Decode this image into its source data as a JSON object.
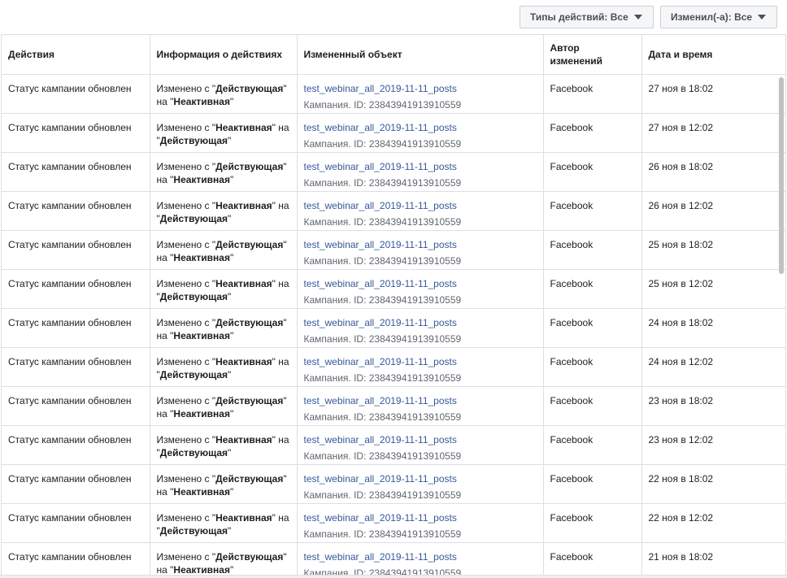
{
  "filters": {
    "action_types_label": "Типы действий: Все",
    "changed_by_label": "Изменил(-а): Все"
  },
  "columns": [
    "Действия",
    "Информация о действиях",
    "Измененный объект",
    "Автор изменений",
    "Дата и время"
  ],
  "info_strings": {
    "changed_from": "Изменено с \"",
    "mid_na_sp": "\" на ",
    "mid_na_nl": "\" на \"",
    "quote_open": "\"",
    "quote_close": "\"",
    "active": "Действующая",
    "inactive": "Неактивная"
  },
  "rows": [
    {
      "action": "Статус кампании обновлен",
      "from": "active",
      "object_name": "test_webinar_all_2019-11-11_posts",
      "object_id": "Кампания. ID: 23843941913910559",
      "author": "Facebook",
      "datetime": "27 ноя в 18:02"
    },
    {
      "action": "Статус кампании обновлен",
      "from": "inactive",
      "object_name": "test_webinar_all_2019-11-11_posts",
      "object_id": "Кампания. ID: 23843941913910559",
      "author": "Facebook",
      "datetime": "27 ноя в 12:02"
    },
    {
      "action": "Статус кампании обновлен",
      "from": "active",
      "object_name": "test_webinar_all_2019-11-11_posts",
      "object_id": "Кампания. ID: 23843941913910559",
      "author": "Facebook",
      "datetime": "26 ноя в 18:02"
    },
    {
      "action": "Статус кампании обновлен",
      "from": "inactive",
      "object_name": "test_webinar_all_2019-11-11_posts",
      "object_id": "Кампания. ID: 23843941913910559",
      "author": "Facebook",
      "datetime": "26 ноя в 12:02"
    },
    {
      "action": "Статус кампании обновлен",
      "from": "active",
      "object_name": "test_webinar_all_2019-11-11_posts",
      "object_id": "Кампания. ID: 23843941913910559",
      "author": "Facebook",
      "datetime": "25 ноя в 18:02"
    },
    {
      "action": "Статус кампании обновлен",
      "from": "inactive",
      "object_name": "test_webinar_all_2019-11-11_posts",
      "object_id": "Кампания. ID: 23843941913910559",
      "author": "Facebook",
      "datetime": "25 ноя в 12:02"
    },
    {
      "action": "Статус кампании обновлен",
      "from": "active",
      "object_name": "test_webinar_all_2019-11-11_posts",
      "object_id": "Кампания. ID: 23843941913910559",
      "author": "Facebook",
      "datetime": "24 ноя в 18:02"
    },
    {
      "action": "Статус кампании обновлен",
      "from": "inactive",
      "object_name": "test_webinar_all_2019-11-11_posts",
      "object_id": "Кампания. ID: 23843941913910559",
      "author": "Facebook",
      "datetime": "24 ноя в 12:02"
    },
    {
      "action": "Статус кампании обновлен",
      "from": "active",
      "object_name": "test_webinar_all_2019-11-11_posts",
      "object_id": "Кампания. ID: 23843941913910559",
      "author": "Facebook",
      "datetime": "23 ноя в 18:02"
    },
    {
      "action": "Статус кампании обновлен",
      "from": "inactive",
      "object_name": "test_webinar_all_2019-11-11_posts",
      "object_id": "Кампания. ID: 23843941913910559",
      "author": "Facebook",
      "datetime": "23 ноя в 12:02"
    },
    {
      "action": "Статус кампании обновлен",
      "from": "active",
      "object_name": "test_webinar_all_2019-11-11_posts",
      "object_id": "Кампания. ID: 23843941913910559",
      "author": "Facebook",
      "datetime": "22 ноя в 18:02"
    },
    {
      "action": "Статус кампании обновлен",
      "from": "inactive",
      "object_name": "test_webinar_all_2019-11-11_posts",
      "object_id": "Кампания. ID: 23843941913910559",
      "author": "Facebook",
      "datetime": "22 ноя в 12:02"
    },
    {
      "action": "Статус кампании обновлен",
      "from": "active",
      "object_name": "test_webinar_all_2019-11-11_posts",
      "object_id": "Кампания. ID: 23843941913910559",
      "author": "Facebook",
      "datetime": "21 ноя в 18:02"
    }
  ]
}
